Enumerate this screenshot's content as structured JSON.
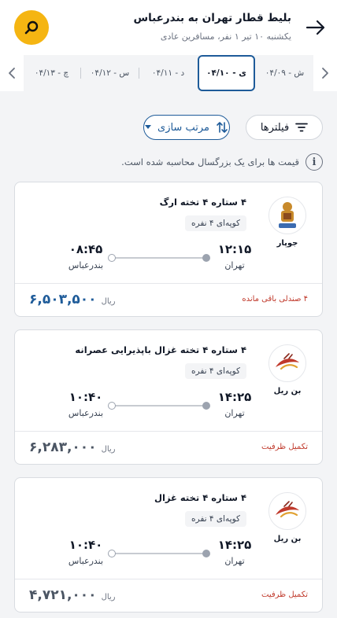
{
  "header": {
    "title": "بلیط قطار تهران به بندرعباس",
    "subtitle": "یکشنبه ۱۰ تیر ۱ نفر، مسافرین عادی"
  },
  "dates": [
    {
      "label": "ش - ۰۴/۰۹",
      "selected": false
    },
    {
      "label": "ی - ۰۴/۱۰",
      "selected": true
    },
    {
      "label": "د - ۰۴/۱۱",
      "selected": false
    },
    {
      "label": "س - ۰۴/۱۲",
      "selected": false
    },
    {
      "label": "چ - ۰۴/۱۳",
      "selected": false
    }
  ],
  "filters": {
    "filters_label": "فیلترها",
    "sort_label": "مرتب سازی"
  },
  "notice": "قیمت ها برای یک بزرگسال محاسبه شده است.",
  "results": [
    {
      "company": "جوپار",
      "wagon": "۴ ستاره ۴ تخته ارگ",
      "coupe": "کوپه‌ای ۴ نفره",
      "dep_time": "۱۲:۱۵",
      "dep_city": "تهران",
      "arr_time": "۰۸:۴۵",
      "arr_city": "بندرعباس",
      "status": "۴ صندلی باقی مانده",
      "price": "۶,۵۰۳,۵۰۰",
      "currency": "ریال",
      "price_color": "#1e5b99"
    },
    {
      "company": "بن ریل",
      "wagon": "۴ ستاره ۴ تخته غزال باپذیرایی عصرانه",
      "coupe": "کوپه‌ای ۴ نفره",
      "dep_time": "۱۴:۲۵",
      "dep_city": "تهران",
      "arr_time": "۱۰:۴۰",
      "arr_city": "بندرعباس",
      "status": "تکمیل ظرفیت",
      "price": "۶,۲۸۳,۰۰۰",
      "currency": "ریال",
      "price_color": "#4b5563"
    },
    {
      "company": "بن ریل",
      "wagon": "۴ ستاره ۴ تخته غزال",
      "coupe": "کوپه‌ای ۴ نفره",
      "dep_time": "۱۴:۲۵",
      "dep_city": "تهران",
      "arr_time": "۱۰:۴۰",
      "arr_city": "بندرعباس",
      "status": "تکمیل ظرفیت",
      "price": "۴,۷۲۱,۰۰۰",
      "currency": "ریال",
      "price_color": "#4b5563"
    }
  ],
  "colors": {
    "accent": "#1e5b99",
    "search_button": "#f5b512",
    "alert": "#c0392b"
  }
}
